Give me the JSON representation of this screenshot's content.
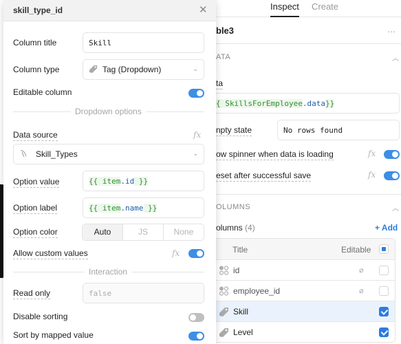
{
  "inspector": {
    "tabs": [
      {
        "label": "Inspect",
        "active": true
      },
      {
        "label": "Create",
        "active": false
      }
    ],
    "component_name": "ble3",
    "more_icon": "…",
    "data_section": {
      "title": "ATA",
      "data_label": "ta",
      "data_value_prefix": "{ ",
      "data_value_ident": "SkillsForEmployee",
      "data_value_prop": ".data",
      "data_value_suffix": "}}",
      "empty_state_label": "npty state",
      "empty_state_value": "No rows found",
      "spinner_label": "ow spinner when data is loading",
      "spinner_on": true,
      "reset_label": "eset after successful save",
      "reset_on": true
    },
    "columns_section": {
      "title": "OLUMNS",
      "count_label": "olumns",
      "count": "(4)",
      "add_label": "+ Add",
      "header_title": "Title",
      "header_editable": "Editable",
      "rows": [
        {
          "label": "id",
          "icon": "grid-icon",
          "hidden": true,
          "editable": false,
          "selected": false
        },
        {
          "label": "employee_id",
          "icon": "grid-icon",
          "hidden": true,
          "editable": false,
          "selected": false
        },
        {
          "label": "Skill",
          "icon": "tag-icon",
          "hidden": false,
          "editable": true,
          "selected": true
        },
        {
          "label": "Level",
          "icon": "tag-icon",
          "hidden": false,
          "editable": true,
          "selected": false
        }
      ]
    }
  },
  "modal": {
    "title": "skill_type_id",
    "column_title_label": "Column title",
    "column_title_value": "Skill",
    "column_type_label": "Column type",
    "column_type_value": "Tag (Dropdown)",
    "editable_label": "Editable column",
    "editable_on": true,
    "dropdown_divider": "Dropdown options",
    "data_source_label": "Data source",
    "data_source_value": "Skill_Types",
    "option_value_label": "Option value",
    "option_value_open": "{{ ",
    "option_value_ident": "item",
    "option_value_prop": ".id",
    "option_value_close": " }}",
    "option_label_label": "Option label",
    "option_label_open": "{{ ",
    "option_label_ident": "item",
    "option_label_prop": ".name",
    "option_label_close": " }}",
    "option_color_label": "Option color",
    "option_color_options": [
      "Auto",
      "JS",
      "None"
    ],
    "option_color_selected": "Auto",
    "allow_custom_label": "Allow custom values",
    "allow_custom_on": true,
    "interaction_divider": "Interaction",
    "read_only_label": "Read only",
    "read_only_placeholder": "false",
    "disable_sorting_label": "Disable sorting",
    "disable_sorting_on": false,
    "sort_mapped_label": "Sort by mapped value",
    "sort_mapped_on": true,
    "fx_label": "fx"
  },
  "colors": {
    "accent": "#2b7de0",
    "toggle_on": "#3e8ee6",
    "code_green": "#2f8f2f",
    "code_blue": "#1d5ea8",
    "selected_row": "#eaf3fd"
  }
}
